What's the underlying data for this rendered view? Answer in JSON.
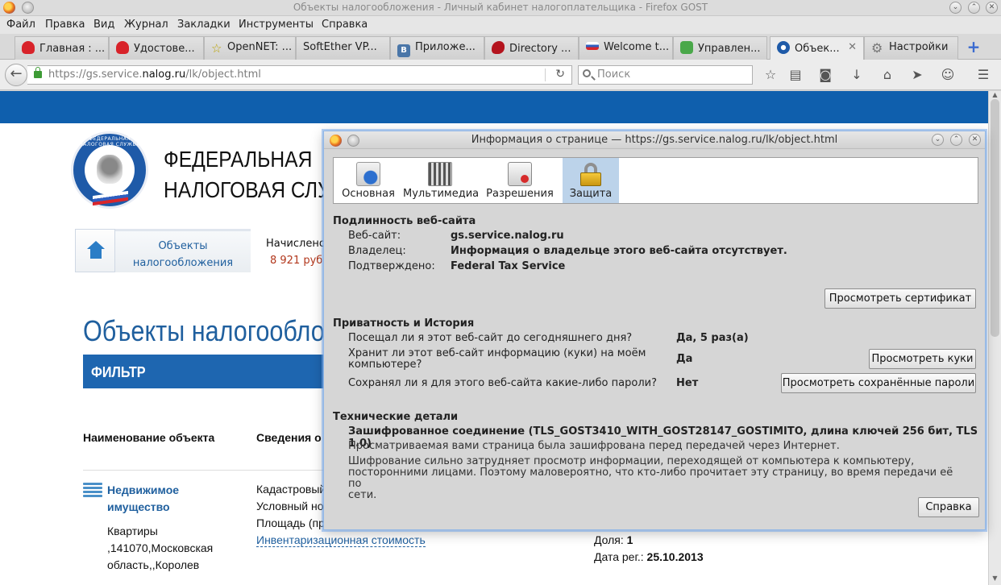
{
  "window": {
    "title": "Объекты налогообложения - Личный кабинет налогоплательщика - Firefox GOST"
  },
  "menu": [
    "Файл",
    "Правка",
    "Вид",
    "Журнал",
    "Закладки",
    "Инструменты",
    "Справка"
  ],
  "tabs": [
    {
      "label": "Главная : ...",
      "icon": "red-mascot-icon"
    },
    {
      "label": "Удостове...",
      "icon": "red-mascot-icon"
    },
    {
      "label": "OpenNET: ...",
      "icon": "star-icon"
    },
    {
      "label": "SoftEther VP...",
      "icon": ""
    },
    {
      "label": "Приложе...",
      "icon": "vk-icon"
    },
    {
      "label": "Directory ...",
      "icon": "red-bird-icon"
    },
    {
      "label": "Welcome t...",
      "icon": "flag-icon"
    },
    {
      "label": "Управлен...",
      "icon": "puzzle-icon"
    },
    {
      "label": "Объек...",
      "icon": "emblem-icon",
      "active": true
    },
    {
      "label": "Настройки",
      "icon": "gear-icon"
    }
  ],
  "nav": {
    "url_prefix": "https://gs.service.",
    "url_domain": "nalog.ru",
    "url_path": "/lk/object.html",
    "search_placeholder": "Поиск"
  },
  "site": {
    "org_line1": "ФЕДЕРАЛЬНАЯ",
    "org_line2": "НАЛОГОВАЯ СЛУЖ",
    "emblem_text": "ФЕДЕРАЛЬНАЯ НАЛОГОВАЯ СЛУЖБА",
    "tab1_line1": "Объекты",
    "tab1_line2": "налогообложения",
    "tab2_label": "Начислено",
    "tab2_sum": "8 921 руб.",
    "page_title": "Объекты налогообло",
    "filter_label": "ФИЛЬТР",
    "col1_header": "Наименование объекта",
    "col2_header": "Сведения о",
    "object_name_line1": "Недвижимое",
    "object_name_line2": "имущество",
    "address_line1": "Квартиры",
    "address_line2": ",141070,Московская",
    "address_line3": "область,,Королев",
    "info1": "Кадастровый",
    "info2": "Условный но",
    "info3": "Площадь (пр",
    "inventory_link": "Инвентаризационная стоимость",
    "share_label": "Доля:",
    "share_value": "1",
    "regdate_label": "Дата рег.:",
    "regdate_value": "25.10.2013"
  },
  "dialog": {
    "title": "Информация о странице — https://gs.service.nalog.ru/lk/object.html",
    "tabs": [
      "Основная",
      "Мультимедиа",
      "Разрешения",
      "Защита"
    ],
    "selected_tab": "Защита",
    "identity": {
      "header": "Подлинность веб-сайта",
      "website_label": "Веб-сайт:",
      "website_value": "gs.service.nalog.ru",
      "owner_label": "Владелец:",
      "owner_value": "Информация о владельце этого веб-сайта отсутствует.",
      "verified_label": "Подтверждено:",
      "verified_value": "Federal Tax Service",
      "view_cert_button": "Просмотреть сертификат"
    },
    "privacy": {
      "header": "Приватность и История",
      "q1": "Посещал ли я этот веб-сайт до сегодняшнего дня?",
      "a1": "Да, 5 раз(а)",
      "q2_line1": "Хранит ли этот веб-сайт информацию (куки) на моём",
      "q2_line2": "компьютере?",
      "a2": "Да",
      "view_cookies_button": "Просмотреть куки",
      "q3": "Сохранял ли я для этого веб-сайта какие-либо пароли?",
      "a3": "Нет",
      "view_passwords_button": "Просмотреть сохранённые пароли"
    },
    "technical": {
      "header": "Технические детали",
      "connection": "Зашифрованное соединение (TLS_GOST3410_WITH_GOST28147_GOSTIMITO, длина ключей 256 бит, TLS 1.0)",
      "para1": "Просматриваемая вами страница была зашифрована перед передачей через Интернет.",
      "para2_line1": "Шифрование сильно затрудняет просмотр информации, переходящей от компьютера к компьютеру,",
      "para2_line2": "посторонними лицами. Поэтому маловероятно, что кто-либо прочитает эту страницу, во время передачи её по",
      "para2_line3": "сети."
    },
    "help_button": "Справка"
  },
  "colors": {
    "site_blue": "#0f5fad",
    "link_blue": "#1f5f9e",
    "sum_red": "#b2371c",
    "selected_tab": "#bcd3ea"
  }
}
